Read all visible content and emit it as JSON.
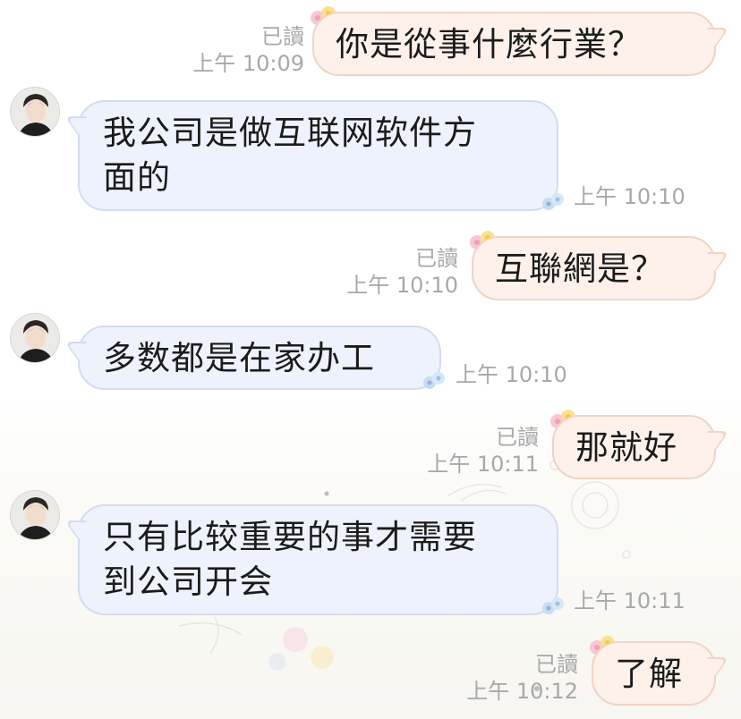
{
  "chat": {
    "messages": [
      {
        "id": "m1",
        "side": "out",
        "text": "你是從事什麼行業？",
        "read": "已讀",
        "time": "上午 10:09"
      },
      {
        "id": "m2",
        "side": "in",
        "lines": [
          "我公司是做互联网软件方",
          "面的"
        ],
        "time": "上午 10:10"
      },
      {
        "id": "m3",
        "side": "out",
        "text": "互聯網是？",
        "read": "已讀",
        "time": "上午 10:10"
      },
      {
        "id": "m4",
        "side": "in",
        "lines": [
          "多数都是在家办工"
        ],
        "time": "上午 10:10"
      },
      {
        "id": "m5",
        "side": "out",
        "text": "那就好",
        "read": "已讀",
        "time": "上午 10:11"
      },
      {
        "id": "m6",
        "side": "in",
        "lines": [
          "只有比较重要的事才需要",
          "到公司开会"
        ],
        "time": "上午 10:11"
      },
      {
        "id": "m7",
        "side": "out",
        "text": "了解",
        "read": "已讀",
        "time": "上午 10:12"
      }
    ]
  },
  "colors": {
    "incoming_bubble": "#edf2fc",
    "outgoing_bubble": "#fdf1ea",
    "meta_text": "#a8a8a8"
  },
  "icons": [
    "user-avatar",
    "flower-sticker-decoration",
    "background-floral-pattern"
  ]
}
